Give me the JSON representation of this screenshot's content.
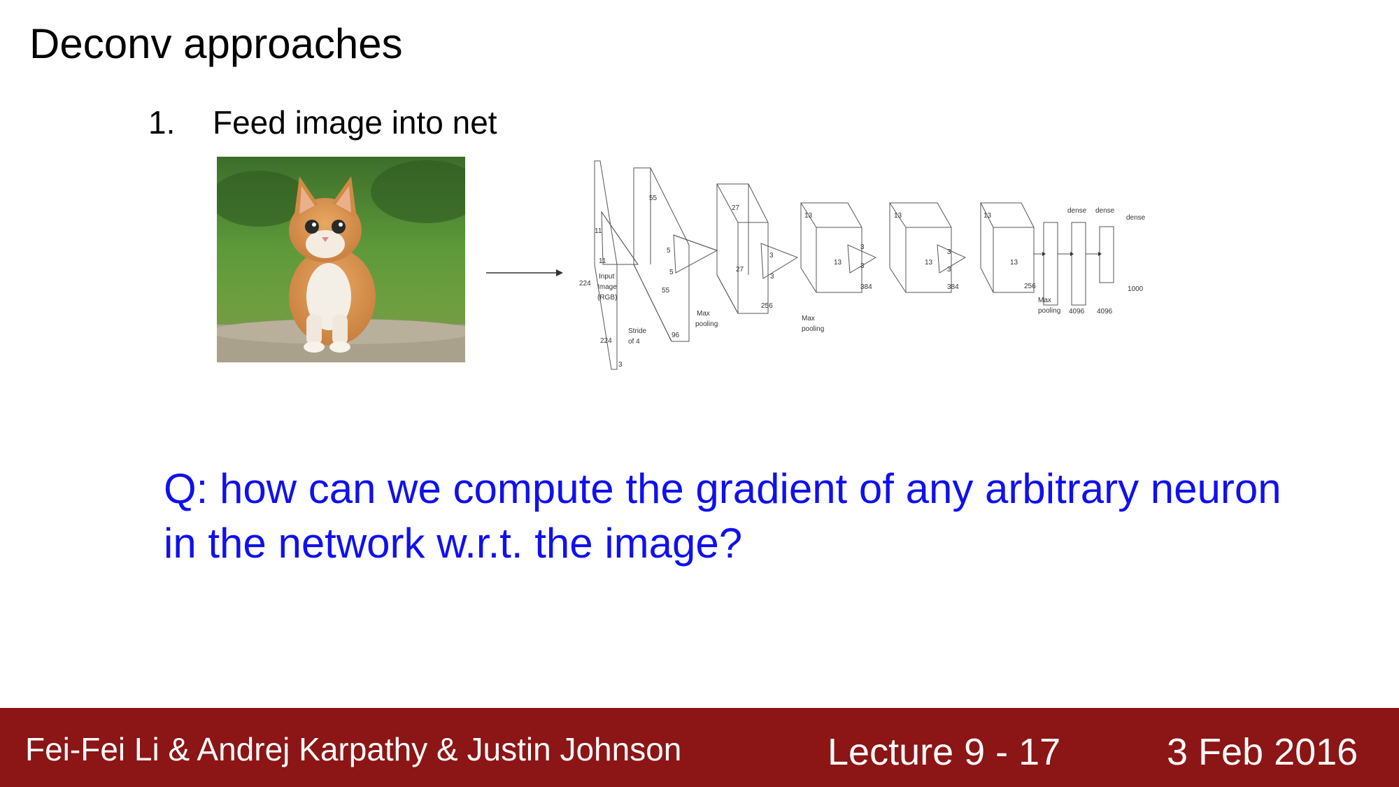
{
  "slide": {
    "title": "Deconv approaches",
    "step_number": "1.",
    "step_text": "Feed image into net",
    "question": "Q: how can we compute the gradient of any arbitrary neuron in the network w.r.t. the image?"
  },
  "diagram": {
    "labels": {
      "l224a": "224",
      "l224b": "224",
      "l3": "3",
      "l11a": "11",
      "l11b": "11",
      "input": "Input",
      "image": "Image",
      "rgb": "(RGB)",
      "stride": "Stride",
      "of4": "of 4",
      "l55a": "55",
      "l55b": "55",
      "l5a": "5",
      "l5b": "5",
      "l96": "96",
      "maxpool1a": "Max",
      "maxpool1b": "pooling",
      "l27a": "27",
      "l27b": "27",
      "l256a": "256",
      "l3a": "3",
      "l3b": "3",
      "maxpool2a": "Max",
      "maxpool2b": "pooling",
      "l13a": "13",
      "l13b": "13",
      "l3c": "3",
      "l3d": "3",
      "l384a": "384",
      "l13c": "13",
      "l13d": "13",
      "l3e": "3",
      "l3f": "3",
      "l384b": "384",
      "l13e": "13",
      "l13f": "13",
      "l256b": "256",
      "maxpool3a": "Max",
      "maxpool3b": "pooling",
      "dense1": "dense",
      "dense2": "dense",
      "dense3": "dense",
      "l4096a": "4096",
      "l4096b": "4096",
      "l1000": "1000"
    }
  },
  "footer": {
    "authors": "Fei-Fei Li & Andrej Karpathy & Justin Johnson",
    "lecture": "Lecture 9 - 17",
    "date": "3 Feb 2016"
  },
  "colors": {
    "question": "#1010ee",
    "footer_bg": "#8c1515"
  }
}
